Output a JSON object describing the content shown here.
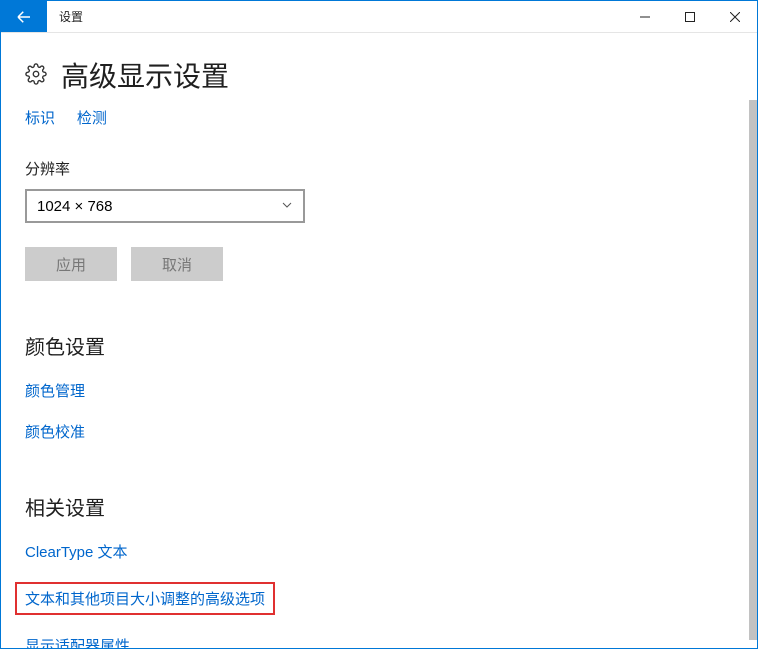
{
  "window": {
    "title": "设置"
  },
  "page": {
    "title": "高级显示设置",
    "identify_link": "标识",
    "detect_link": "检测",
    "resolution_label": "分辨率",
    "resolution_value": "1024 × 768",
    "apply_btn": "应用",
    "cancel_btn": "取消"
  },
  "color_section": {
    "title": "颜色设置",
    "color_mgmt": "颜色管理",
    "color_calib": "颜色校准"
  },
  "related_section": {
    "title": "相关设置",
    "cleartype": "ClearType 文本",
    "advanced_sizing": "文本和其他项目大小调整的高级选项",
    "adapter_props": "显示适配器属性"
  }
}
